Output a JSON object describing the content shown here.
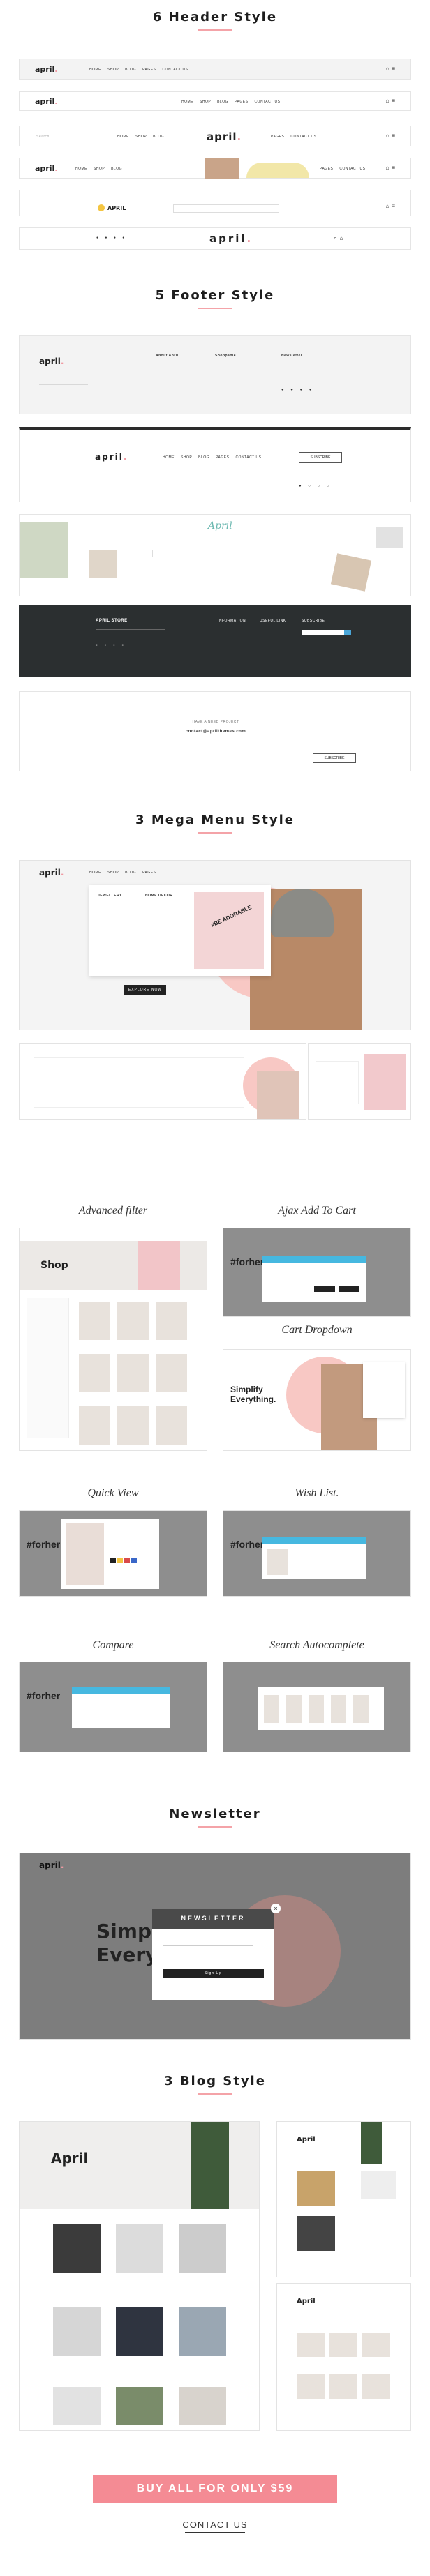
{
  "sections": {
    "header": "6 Header Style",
    "footer": "5 Footer Style",
    "mega": "3 Mega Menu Style",
    "newsletter": "Newsletter",
    "blog": "3 Blog Style"
  },
  "brand": {
    "logo": "april",
    "logo_dot": ".",
    "accent": "#f48b94"
  },
  "headers": {
    "nav": [
      "HOME",
      "SHOP",
      "BLOG",
      "PAGES",
      "CONTACT US"
    ],
    "free_shipping": "APRIL",
    "search_placeholder": "Search..."
  },
  "footers": {
    "f1": {
      "col1": "About April",
      "col2": "Shoppable",
      "col3": "Newsletter"
    },
    "f2": {
      "btn": "SUBSCRIBE"
    },
    "f3": {
      "script_logo": "April"
    },
    "f4": {
      "store": "APRIL STORE",
      "col1": "INFORMATION",
      "col2": "USEFUL LINK",
      "col3": "SUBSCRIBE"
    },
    "f5": {
      "text": "HAVE A NEED PROJECT",
      "email": "contact@aprilthemes.com",
      "btn": "SUBSCRIBE"
    }
  },
  "mega": {
    "col1": "JEWELLERY",
    "col2": "HOME DECOR",
    "btn": "EXPLORE NOW",
    "sticker": "#BE ADORABLE"
  },
  "features": {
    "advanced_filter": "Advanced filter",
    "ajax_add": "Ajax Add To Cart",
    "cart_dropdown": "Cart Dropdown",
    "quick_view": "Quick View",
    "wish_list": "Wish List.",
    "compare": "Compare",
    "search_auto": "Search Autocomplete",
    "shop_title": "Shop",
    "simplify": "Simplify Everything.",
    "forher": "#forher"
  },
  "newsletter_popup": {
    "title": "NEWSLETTER",
    "btn": "Sign Up",
    "bg_text": "Simplify Everything."
  },
  "blog": {
    "title": "April"
  },
  "cta": {
    "label": "BUY ALL  FOR ONLY $59"
  },
  "contact": {
    "label": "CONTACT US"
  }
}
